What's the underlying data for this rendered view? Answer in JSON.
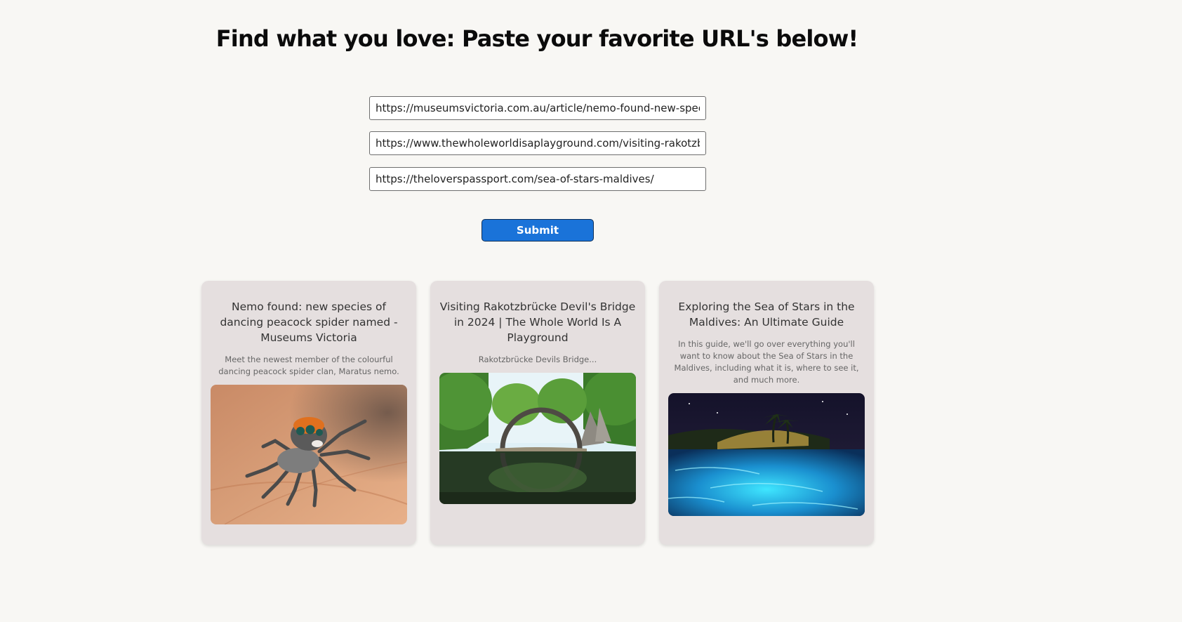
{
  "header": {
    "title": "Find what you love: Paste your favorite URL's below!"
  },
  "form": {
    "urls": [
      "https://museumsvictoria.com.au/article/nemo-found-new-species-of-dancing-peacock-spider-named/",
      "https://www.thewholeworldisaplayground.com/visiting-rakotzbrucke-devils-bridge/",
      "https://theloverspassport.com/sea-of-stars-maldives/"
    ],
    "submit_label": "Submit"
  },
  "cards": [
    {
      "title": "Nemo found: new species of dancing peacock spider named - Museums Victoria",
      "description": "Meet the newest member of the colourful dancing peacock spider clan, Maratus nemo.",
      "image_alt": "peacock spider on a leaf"
    },
    {
      "title": "Visiting Rakotzbrücke Devil's Bridge in 2024 | The Whole World Is A Playground",
      "description": "Rakotzbrücke Devils Bridge...",
      "image_alt": "Rakotzbrücke arch bridge reflected in a lake"
    },
    {
      "title": "Exploring the Sea of Stars in the Maldives: An Ultimate Guide",
      "description": "In this guide, we'll go over everything you'll want to know about the Sea of Stars in the Maldives, including what it is, where to see it, and much more.",
      "image_alt": "glowing bioluminescent beach at night"
    }
  ],
  "colors": {
    "background": "#f8f7f4",
    "card": "#e5dfdf",
    "accent": "#1a73d9"
  }
}
